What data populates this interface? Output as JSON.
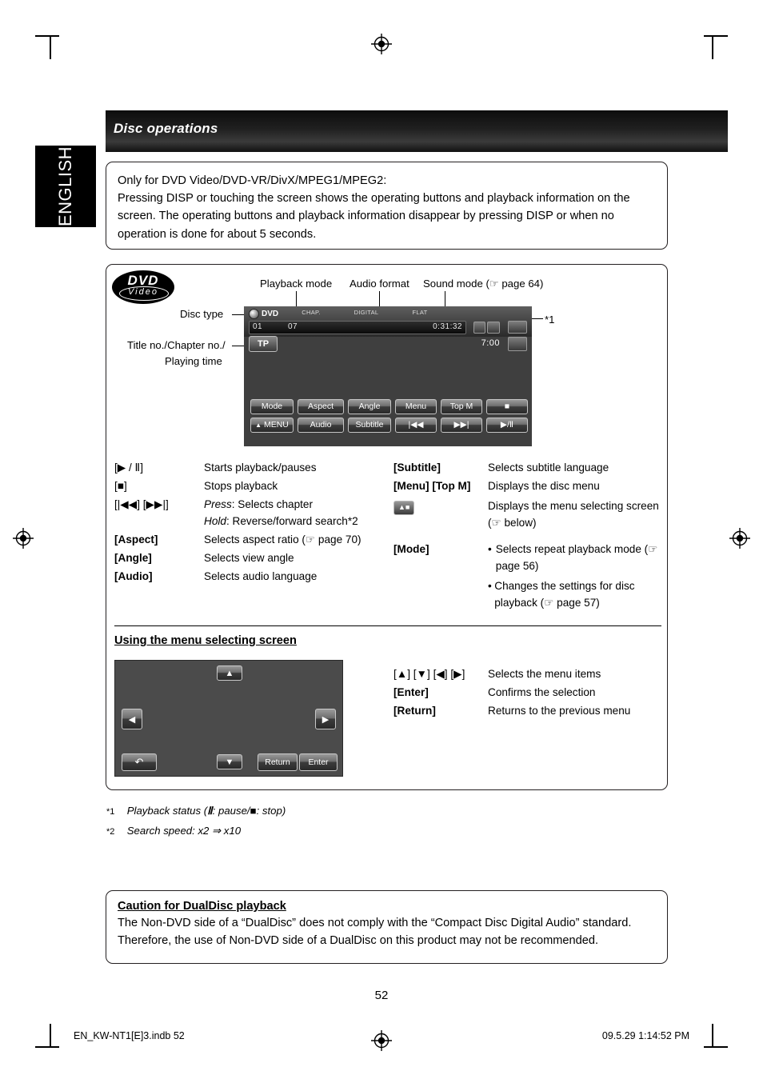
{
  "language_tab": "ENGLISH",
  "header": {
    "title": "Disc operations"
  },
  "intro": {
    "line1": "Only for DVD Video/DVD-VR/DivX/MPEG1/MPEG2:",
    "line2": "Pressing DISP or touching the screen shows the operating buttons and playback information on the screen. The operating buttons and playback information disappear by pressing DISP or when no operation is done for about 5 seconds."
  },
  "logo": {
    "line1": "DVD",
    "line2": "Video"
  },
  "callouts": {
    "playback_mode": "Playback mode",
    "audio_format": "Audio format",
    "sound_mode": "Sound mode (☞ page 64)",
    "disc_type": "Disc type",
    "title_chapter": "Title no./Chapter no./",
    "playing_time": "Playing time",
    "note_ref": "*1"
  },
  "monitor": {
    "disc_label": "DVD",
    "playback_mode_text": "CHAP.",
    "audio_format_text": "DIGITAL",
    "sound_mode_text": "FLAT",
    "title_no": "01",
    "chapter_no": "07",
    "time": "0:31:32",
    "tp_button": "TP",
    "clock": "7:00",
    "buttons_row1": [
      "Mode",
      "Aspect",
      "Angle",
      "Menu",
      "Top M",
      "■"
    ],
    "buttons_row2": [
      "MENU",
      "Audio",
      "Subtitle",
      "|◀◀",
      "▶▶|",
      "▶/Ⅱ"
    ]
  },
  "keys_left": [
    {
      "key": "[▶ / Ⅱ]",
      "desc": "Starts playback/pauses"
    },
    {
      "key": "[■]",
      "desc": "Stops playback"
    },
    {
      "key": "[|◀◀] [▶▶|]",
      "desc_italic1": "Press",
      "desc1": ": Selects chapter",
      "desc_italic2": "Hold",
      "desc2": ": Reverse/forward search*2"
    },
    {
      "key": "[Aspect]",
      "desc": "Selects aspect ratio (☞ page 70)"
    },
    {
      "key": "[Angle]",
      "desc": "Selects view angle"
    },
    {
      "key": "[Audio]",
      "desc": "Selects audio language"
    }
  ],
  "keys_right": [
    {
      "key": "[Subtitle]",
      "desc": "Selects subtitle language"
    },
    {
      "key": "[Menu] [Top M]",
      "desc": "Displays the disc menu"
    },
    {
      "key": "[MENU-icon]",
      "desc": "Displays the menu selecting screen (☞ below)"
    },
    {
      "key": "[Mode]",
      "bullets": [
        "Selects repeat playback mode (☞ page 56)",
        "Changes the settings for disc playback (☞ page 57)"
      ]
    }
  ],
  "menu_section": {
    "heading": "Using the menu selecting screen",
    "screen_buttons": {
      "return": "Return",
      "enter": "Enter"
    },
    "keys": [
      {
        "key": "[▲] [▼] [◀] [▶]",
        "desc": "Selects the menu items"
      },
      {
        "key": "[Enter]",
        "desc": "Confirms the selection"
      },
      {
        "key": "[Return]",
        "desc": "Returns to the previous menu"
      }
    ]
  },
  "footnotes": {
    "fn1_mark": "*1",
    "fn1_text_a": "Playback status (",
    "fn1_pause": "Ⅱ",
    "fn1_text_b": ": pause/",
    "fn1_stop": "■",
    "fn1_text_c": ": stop)",
    "fn2_mark": "*2",
    "fn2_text": "Search speed: x2 ⇒ x10"
  },
  "caution": {
    "heading": "Caution for DualDisc playback",
    "text": "The Non-DVD side of a “DualDisc” does not comply with the “Compact Disc Digital Audio” standard. Therefore, the use of Non-DVD side of a DualDisc on this product may not be recommended."
  },
  "page_number": "52",
  "footer": {
    "left": "EN_KW-NT1[E]3.indb   52",
    "right": "09.5.29   1:14:52 PM"
  }
}
